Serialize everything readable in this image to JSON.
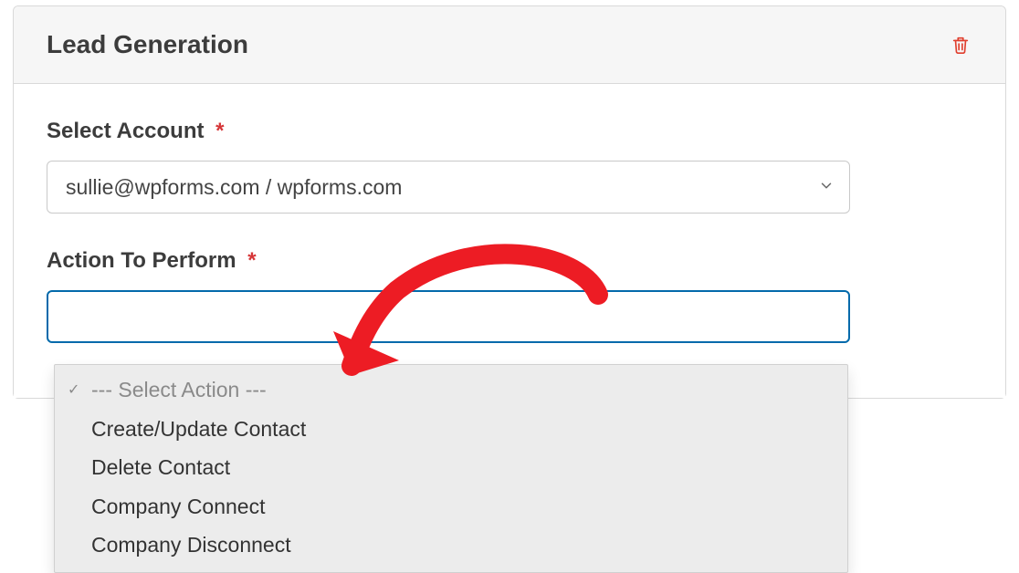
{
  "panel": {
    "title": "Lead Generation"
  },
  "fields": {
    "account": {
      "label": "Select Account",
      "value": "sullie@wpforms.com / wpforms.com"
    },
    "action": {
      "label": "Action To Perform",
      "placeholder": "--- Select Action ---",
      "options": [
        "Create/Update Contact",
        "Delete Contact",
        "Company Connect",
        "Company Disconnect"
      ]
    }
  },
  "colors": {
    "focus": "#036aab",
    "danger": "#e03e2d"
  }
}
